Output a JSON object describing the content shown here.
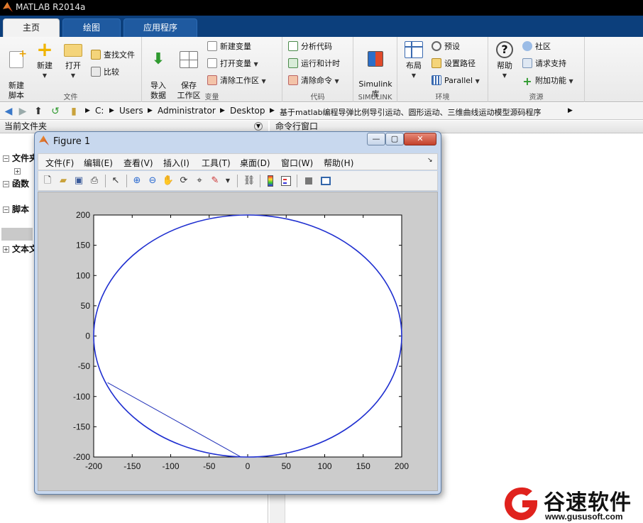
{
  "app": {
    "title": "MATLAB R2014a"
  },
  "tabs": [
    {
      "label": "主页",
      "active": true
    },
    {
      "label": "绘图",
      "active": false
    },
    {
      "label": "应用程序",
      "active": false
    }
  ],
  "ribbon": {
    "file": {
      "section_label": "文件",
      "new_script": "新建\n脚本",
      "new": "新建",
      "open": "打开",
      "find_files": "查找文件",
      "compare": "比较"
    },
    "variable": {
      "section_label": "变量",
      "import": "导入\n数据",
      "save_workspace": "保存\n工作区",
      "new_variable": "新建变量",
      "open_variable": "打开变量",
      "clear_workspace": "清除工作区"
    },
    "code": {
      "section_label": "代码",
      "analyze": "分析代码",
      "run_time": "运行和计时",
      "clear_commands": "清除命令"
    },
    "simulink": {
      "section_label": "SIMULINK",
      "library": "Simulink\n库"
    },
    "environment": {
      "section_label": "环境",
      "layout": "布局",
      "preferences": "预设",
      "set_path": "设置路径",
      "parallel": "Parallel"
    },
    "resources": {
      "section_label": "资源",
      "help": "帮助",
      "community": "社区",
      "request_support": "请求支持",
      "addons": "附加功能"
    }
  },
  "address": {
    "crumbs": [
      "C:",
      "Users",
      "Administrator",
      "Desktop",
      "基于matlab编程导弹比例导引运动、圆形运动、三维曲线运动模型源码程序"
    ]
  },
  "left_pane": {
    "title": "当前文件夹",
    "tree": [
      "文件夹",
      "函数",
      "脚本",
      "文本文"
    ]
  },
  "right_pane": {
    "title": "命令行窗口"
  },
  "figure": {
    "title": "Figure 1",
    "menu": [
      "文件(F)",
      "编辑(E)",
      "查看(V)",
      "插入(I)",
      "工具(T)",
      "桌面(D)",
      "窗口(W)",
      "帮助(H)"
    ],
    "window_buttons": {
      "minimize": "—",
      "restore": "▢",
      "close": "✕"
    }
  },
  "chart_data": {
    "type": "line",
    "title": "",
    "xlabel": "",
    "ylabel": "",
    "xlim": [
      -200,
      200
    ],
    "ylim": [
      -200,
      200
    ],
    "xticks": [
      -200,
      -150,
      -100,
      -50,
      0,
      50,
      100,
      150,
      200
    ],
    "yticks": [
      -200,
      -150,
      -100,
      -50,
      0,
      50,
      100,
      150,
      200
    ],
    "grid": false,
    "series": [
      {
        "kind": "circle",
        "center": [
          0,
          0
        ],
        "radius": 200,
        "color": "#1f2fd0"
      },
      {
        "kind": "line",
        "x": [
          -182,
          -10
        ],
        "y": [
          -77,
          -199
        ],
        "color": "#1f2fb8"
      }
    ]
  },
  "watermark": {
    "name": "谷速软件",
    "url": "www.gususoft.com"
  },
  "colors": {
    "tabbar": "#0c3f7c",
    "accent_red": "#e0221d",
    "plot_line": "#1f2fd0"
  }
}
